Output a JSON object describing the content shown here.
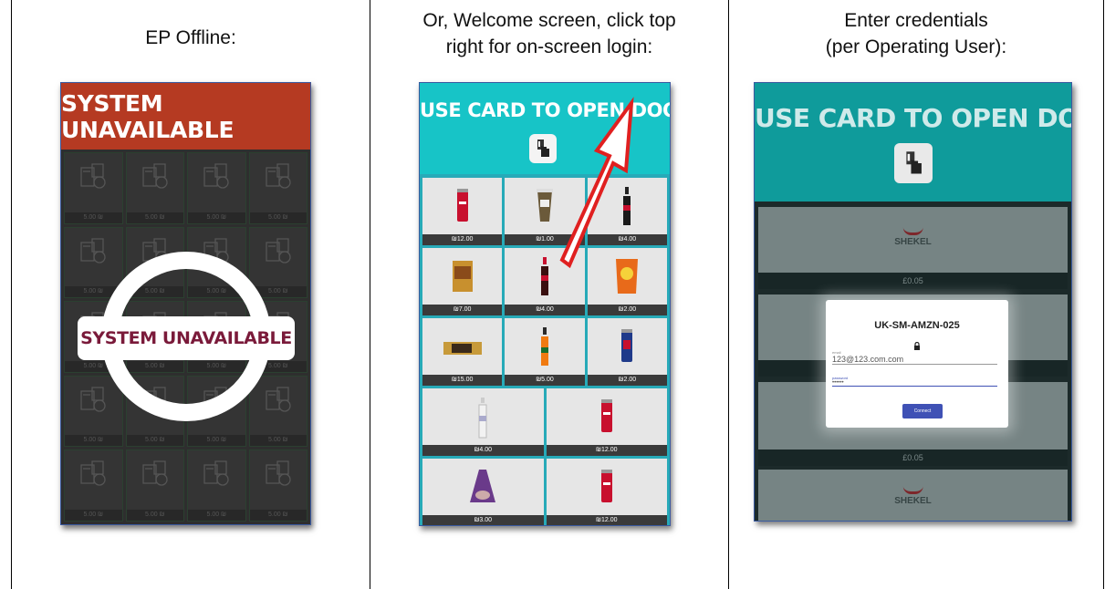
{
  "columns": [
    {
      "heading": "EP Offline:"
    },
    {
      "heading_line1": "Or, Welcome screen, click top",
      "heading_line2": "right for on-screen login:"
    },
    {
      "heading_line1": "Enter credentials",
      "heading_line2": "(per Operating User):"
    }
  ],
  "panel_offline": {
    "banner": "SYSTEM UNAVAILABLE",
    "overlay_label": "SYSTEM UNAVAILABLE",
    "tile_price": "5.00 ₪",
    "banner_color": "#b53a22",
    "icon": "grocery-bag-icon"
  },
  "panel_welcome": {
    "title": "USE CARD TO OPEN DOOR",
    "icon": "hand-card-icon",
    "accent_color": "#17c4c7",
    "products": [
      {
        "price": "₪12.00",
        "kind": "can-red"
      },
      {
        "price": "₪1.00",
        "kind": "cup"
      },
      {
        "price": "₪4.00",
        "kind": "bottle-dark"
      },
      {
        "price": "₪7.00",
        "kind": "box"
      },
      {
        "price": "₪4.00",
        "kind": "bottle-red"
      },
      {
        "price": "₪2.00",
        "kind": "chips"
      },
      {
        "price": "₪15.00",
        "kind": "bar"
      },
      {
        "price": "₪5.00",
        "kind": "bottle-orange"
      },
      {
        "price": "₪2.00",
        "kind": "can-blue"
      }
    ],
    "products_wide": [
      {
        "price": "₪4.00",
        "kind": "bottle-water"
      },
      {
        "price": "₪12.00",
        "kind": "can-red"
      },
      {
        "price": "₪3.00",
        "kind": "bag-purple"
      },
      {
        "price": "₪12.00",
        "kind": "can-red"
      }
    ]
  },
  "panel_login": {
    "title": "USE CARD TO OPEN DOOR",
    "logo_text": "SHEKEL",
    "price_top": "£0.05",
    "price_bottom": "£0.05",
    "dialog": {
      "device_id": "UK-SM-AMZN-025",
      "email_label": "email",
      "email_value": "123@123.com.com",
      "password_label": "password",
      "password_value": "••••••",
      "connect_label": "Connect"
    }
  }
}
